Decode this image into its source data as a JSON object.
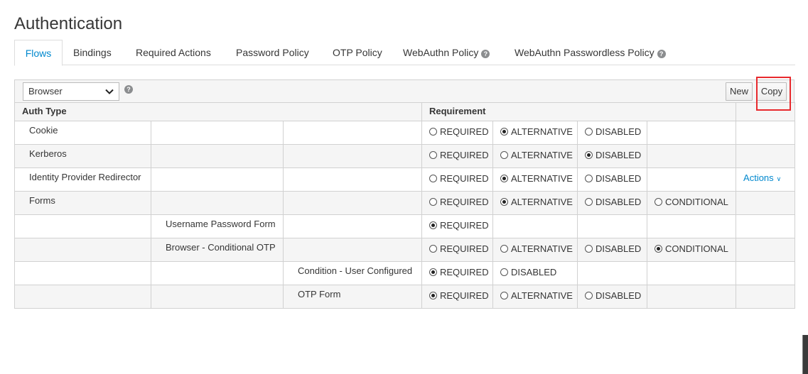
{
  "page": {
    "title": "Authentication"
  },
  "tabs": [
    {
      "label": "Flows",
      "active": true,
      "help": false
    },
    {
      "label": "Bindings",
      "active": false,
      "help": false
    },
    {
      "label": "Required Actions",
      "active": false,
      "help": false
    },
    {
      "label": "Password Policy",
      "active": false,
      "help": false
    },
    {
      "label": "OTP Policy",
      "active": false,
      "help": false
    },
    {
      "label": "WebAuthn Policy",
      "active": false,
      "help": true
    },
    {
      "label": "WebAuthn Passwordless Policy",
      "active": false,
      "help": true
    }
  ],
  "toolbar": {
    "flow_select": "Browser",
    "new_label": "New",
    "copy_label": "Copy",
    "highlight_color": "#e8292d"
  },
  "table": {
    "headers": {
      "auth_type": "Auth Type",
      "requirement": "Requirement"
    },
    "rows": [
      {
        "level": 0,
        "name": "Cookie",
        "options": [
          {
            "label": "REQUIRED",
            "checked": false
          },
          {
            "label": "ALTERNATIVE",
            "checked": true
          },
          {
            "label": "DISABLED",
            "checked": false
          }
        ],
        "actions": ""
      },
      {
        "level": 0,
        "name": "Kerberos",
        "options": [
          {
            "label": "REQUIRED",
            "checked": false
          },
          {
            "label": "ALTERNATIVE",
            "checked": false
          },
          {
            "label": "DISABLED",
            "checked": true
          }
        ],
        "actions": ""
      },
      {
        "level": 0,
        "name": "Identity Provider Redirector",
        "options": [
          {
            "label": "REQUIRED",
            "checked": false
          },
          {
            "label": "ALTERNATIVE",
            "checked": true
          },
          {
            "label": "DISABLED",
            "checked": false
          }
        ],
        "actions": "Actions"
      },
      {
        "level": 0,
        "name": "Forms",
        "options": [
          {
            "label": "REQUIRED",
            "checked": false
          },
          {
            "label": "ALTERNATIVE",
            "checked": true
          },
          {
            "label": "DISABLED",
            "checked": false
          },
          {
            "label": "CONDITIONAL",
            "checked": false
          }
        ],
        "actions": ""
      },
      {
        "level": 1,
        "name": "Username Password Form",
        "options": [
          {
            "label": "REQUIRED",
            "checked": true
          }
        ],
        "actions": ""
      },
      {
        "level": 1,
        "name": "Browser - Conditional OTP",
        "options": [
          {
            "label": "REQUIRED",
            "checked": false
          },
          {
            "label": "ALTERNATIVE",
            "checked": false
          },
          {
            "label": "DISABLED",
            "checked": false
          },
          {
            "label": "CONDITIONAL",
            "checked": true
          }
        ],
        "actions": ""
      },
      {
        "level": 2,
        "name": "Condition - User Configured",
        "options": [
          {
            "label": "REQUIRED",
            "checked": true
          },
          {
            "label": "DISABLED",
            "checked": false
          }
        ],
        "actions": ""
      },
      {
        "level": 2,
        "name": "OTP Form",
        "options": [
          {
            "label": "REQUIRED",
            "checked": true
          },
          {
            "label": "ALTERNATIVE",
            "checked": false
          },
          {
            "label": "DISABLED",
            "checked": false
          }
        ],
        "actions": ""
      }
    ]
  }
}
